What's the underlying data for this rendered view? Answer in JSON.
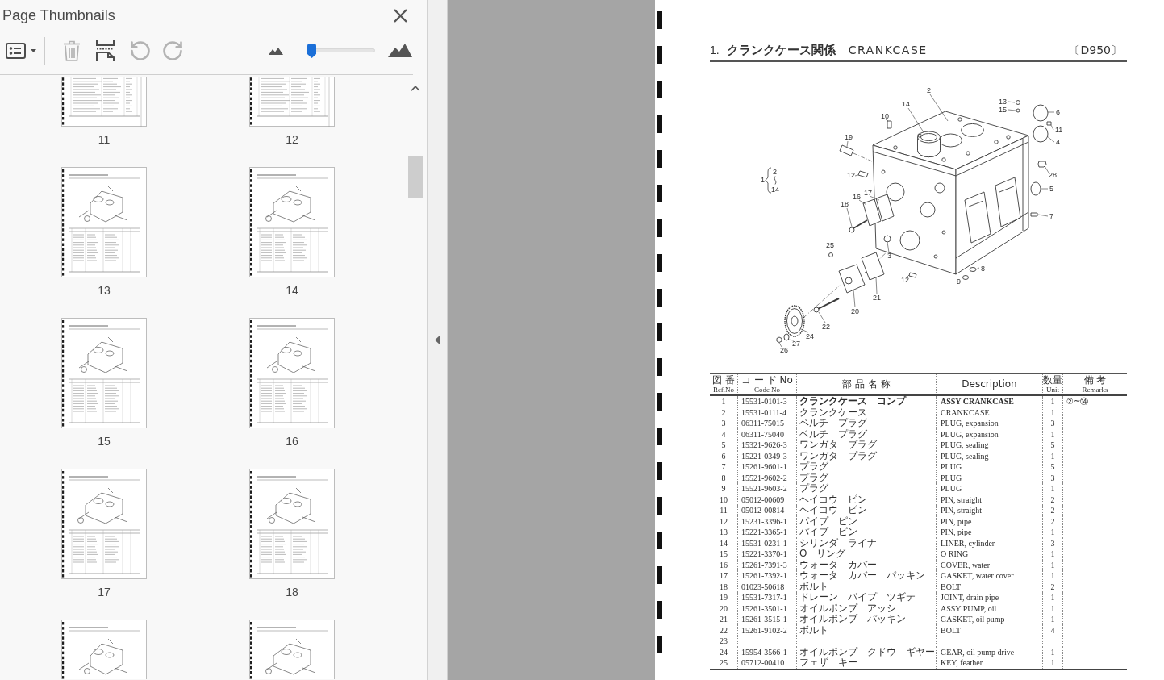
{
  "panel": {
    "title": "Page Thumbnails",
    "toolbar": [
      {
        "kind": "options",
        "disabled": false
      },
      {
        "kind": "delete",
        "disabled": true
      },
      {
        "kind": "insert",
        "disabled": false
      },
      {
        "kind": "rotate_left",
        "disabled": true
      },
      {
        "kind": "rotate_right",
        "disabled": true
      }
    ],
    "thumbnail_size": {
      "level": 0.05
    },
    "thumbnails": [
      {
        "label": "11",
        "kind": "text_page"
      },
      {
        "label": "12",
        "kind": "text_page"
      },
      {
        "label": "13",
        "kind": "diagram_page"
      },
      {
        "label": "14",
        "kind": "diagram_page"
      },
      {
        "label": "15",
        "kind": "diagram_page"
      },
      {
        "label": "16",
        "kind": "diagram_page"
      },
      {
        "label": "17",
        "kind": "diagram_page"
      },
      {
        "label": "18",
        "kind": "diagram_page"
      },
      {
        "kind": "diagram_page"
      },
      {
        "kind": "diagram_page"
      }
    ]
  },
  "page": {
    "section_number": "1.",
    "title_ja": "クランクケース関係",
    "title_en": "CRANKCASE",
    "model": "〔D950〕",
    "diagram": {
      "callouts": [
        "2",
        "14",
        "10",
        "13",
        "15",
        "6",
        "11",
        "4",
        "19",
        "28",
        "12",
        "5",
        "17",
        "16",
        "18",
        "7",
        "3",
        "25",
        "8",
        "9",
        "12",
        "21",
        "20",
        "22",
        "24",
        "27",
        "26"
      ],
      "assembly_callout": {
        "ref": "1",
        "from": "2",
        "to": "14"
      }
    },
    "table": {
      "columns": [
        {
          "label": "図 番",
          "sublabel": "Ref.No"
        },
        {
          "label": "コ ー ド No",
          "sublabel": "Code No"
        },
        {
          "label": "部 品 名 称"
        },
        {
          "label": "Description"
        },
        {
          "label": "数量",
          "sublabel": "Unit"
        },
        {
          "label": "備 考",
          "sublabel": "Remarks"
        }
      ],
      "rows": [
        {
          "ref": "1",
          "code": "15531-0101-3",
          "name": "クランクケース　コンプ",
          "description": "ASSY CRANKCASE",
          "unit": "1",
          "remarks": "②~⑭",
          "emphasis": true
        },
        {
          "ref": "2",
          "code": "15531-0111-4",
          "name": "クランクケース",
          "description": "CRANKCASE",
          "unit": "1",
          "emphasis": false
        },
        {
          "ref": "3",
          "code": "06311-75015",
          "name": "ベルチ　プラグ",
          "description": "PLUG, expansion",
          "unit": "3",
          "emphasis": false
        },
        {
          "ref": "4",
          "code": "06311-75040",
          "name": "ベルチ　プラグ",
          "description": "PLUG, expansion",
          "unit": "1",
          "emphasis": false
        },
        {
          "ref": "5",
          "code": "15321-9626-3",
          "name": "ワンガタ　プラグ",
          "description": "PLUG, sealing",
          "unit": "5",
          "emphasis": false
        },
        {
          "ref": "6",
          "code": "15221-0349-3",
          "name": "ワンガタ　プラグ",
          "description": "PLUG, sealing",
          "unit": "1",
          "emphasis": false
        },
        {
          "ref": "7",
          "code": "15261-9601-1",
          "name": "プラグ",
          "description": "PLUG",
          "unit": "5",
          "emphasis": false
        },
        {
          "ref": "8",
          "code": "15521-9602-2",
          "name": "プラグ",
          "description": "PLUG",
          "unit": "3",
          "emphasis": false
        },
        {
          "ref": "9",
          "code": "15521-9603-2",
          "name": "プラグ",
          "description": "PLUG",
          "unit": "1",
          "emphasis": false
        },
        {
          "ref": "10",
          "code": "05012-00609",
          "name": "ヘイコウ　ピン",
          "description": "PIN, straight",
          "unit": "2",
          "emphasis": false
        },
        {
          "ref": "11",
          "code": "05012-00814",
          "name": "ヘイコウ　ピン",
          "description": "PIN, straight",
          "unit": "2",
          "emphasis": false
        },
        {
          "ref": "12",
          "code": "15231-3396-1",
          "name": "パイプ　ピン",
          "description": "PIN, pipe",
          "unit": "2",
          "emphasis": false
        },
        {
          "ref": "13",
          "code": "15221-3365-1",
          "name": "パイプ　ピン",
          "description": "PIN, pipe",
          "unit": "1",
          "emphasis": false
        },
        {
          "ref": "14",
          "code": "15531-0231-1",
          "name": "シリンダ　ライナ",
          "description": "LINER, cylinder",
          "unit": "3",
          "emphasis": false
        },
        {
          "ref": "15",
          "code": "15221-3370-1",
          "name": "O　リング",
          "description": "O RING",
          "unit": "1",
          "emphasis": false
        },
        {
          "ref": "16",
          "code": "15261-7391-3",
          "name": "ウォータ　カバー",
          "description": "COVER, water",
          "unit": "1",
          "emphasis": false
        },
        {
          "ref": "17",
          "code": "15261-7392-1",
          "name": "ウォータ　カバー　パッキン",
          "description": "GASKET, water cover",
          "unit": "1",
          "emphasis": false
        },
        {
          "ref": "18",
          "code": "01023-50618",
          "name": "ボルト",
          "description": "BOLT",
          "unit": "2",
          "emphasis": false
        },
        {
          "ref": "19",
          "code": "15531-7317-1",
          "name": "ドレーン　パイプ　ツギテ",
          "description": "JOINT, drain pipe",
          "unit": "1",
          "emphasis": false
        },
        {
          "ref": "20",
          "code": "15261-3501-1",
          "name": "オイルポンプ　アッシ",
          "description": "ASSY PUMP, oil",
          "unit": "1",
          "emphasis": false
        },
        {
          "ref": "21",
          "code": "15261-3515-1",
          "name": "オイルポンプ　パッキン",
          "description": "GASKET, oil pump",
          "unit": "1",
          "emphasis": false
        },
        {
          "ref": "22",
          "code": "15261-9102-2",
          "name": "ボルト",
          "description": "BOLT",
          "unit": "4",
          "emphasis": false
        },
        {
          "ref": "23"
        },
        {
          "ref": "24",
          "code": "15954-3566-1",
          "name": "オイルポンプ　クドウ　ギヤー",
          "description": "GEAR, oil pump drive",
          "unit": "1",
          "emphasis": false
        },
        {
          "ref": "25",
          "code": "05712-00410",
          "name": "フェザ　キー",
          "description": "KEY, feather",
          "unit": "1",
          "emphasis": false
        }
      ]
    }
  }
}
